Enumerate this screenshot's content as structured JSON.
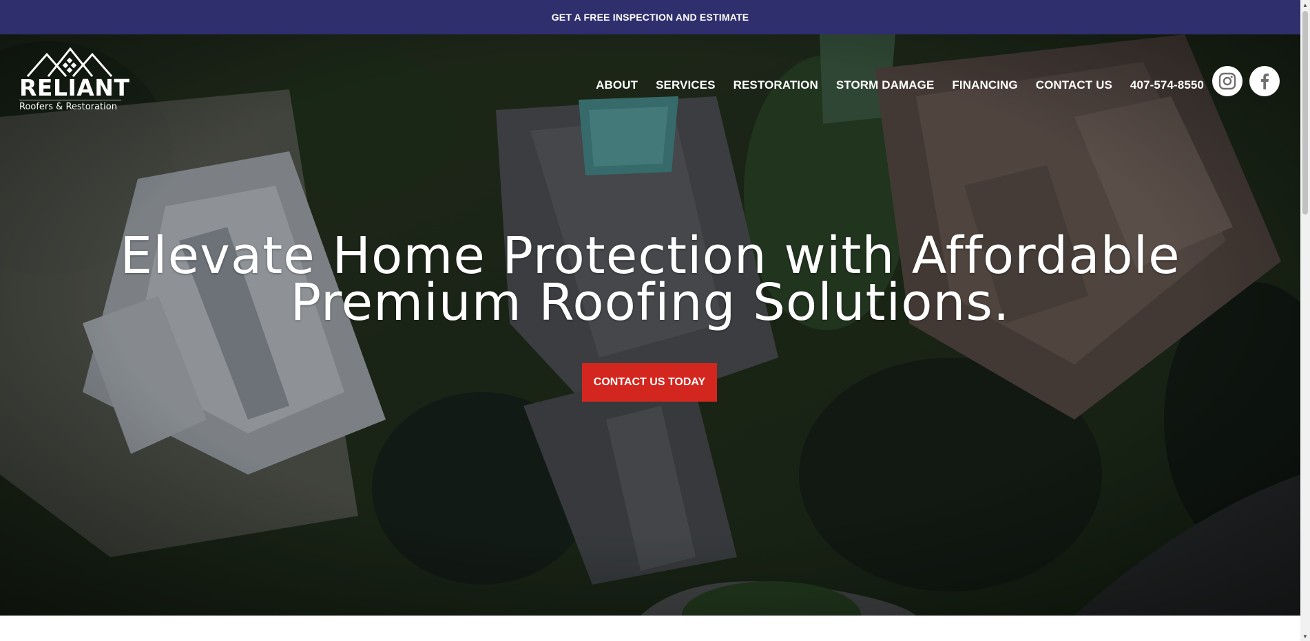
{
  "top_banner": {
    "text": "GET A FREE INSPECTION AND ESTIMATE"
  },
  "logo": {
    "wordmark": "RELIANT",
    "tagline": "Roofers & Restoration"
  },
  "nav": {
    "items": [
      "ABOUT",
      "SERVICES",
      "RESTORATION",
      "STORM DAMAGE",
      "FINANCING",
      "CONTACT US"
    ],
    "phone": "407-574-8550"
  },
  "social": {
    "icons": [
      "instagram-icon",
      "facebook-icon"
    ]
  },
  "hero": {
    "headline": "Elevate Home Protection with Affordable Premium Roofing Solutions.",
    "cta_label": "CONTACT US TODAY"
  },
  "colors": {
    "banner_bg": "#2f2f6e",
    "cta_bg": "#d3261f",
    "text_light": "#ffffff"
  }
}
